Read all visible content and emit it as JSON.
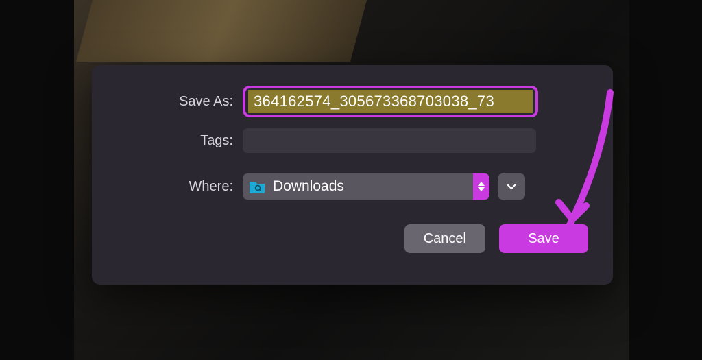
{
  "dialog": {
    "saveAsLabel": "Save As:",
    "filename": "364162574_305673368703038_73",
    "tagsLabel": "Tags:",
    "tagsValue": "",
    "whereLabel": "Where:",
    "whereFolder": "Downloads",
    "cancelLabel": "Cancel",
    "saveLabel": "Save"
  },
  "colors": {
    "accent": "#c93ae0",
    "dialogBg": "#2b2730",
    "inputBg": "#3a3640",
    "selectBg": "#5a5660",
    "selectedTextBg": "#8a7a2e"
  }
}
